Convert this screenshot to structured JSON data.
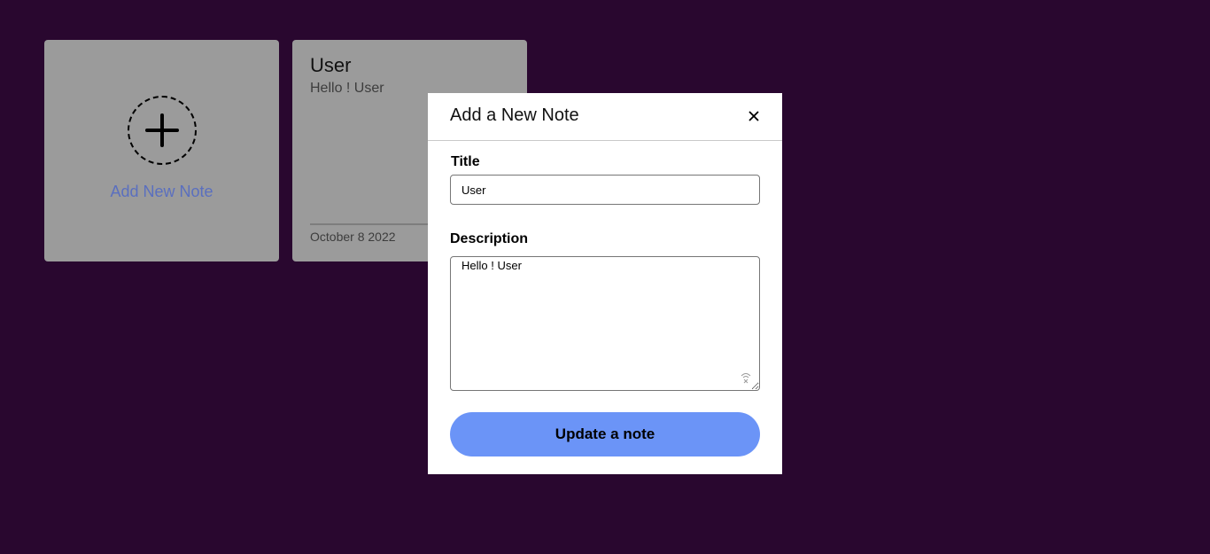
{
  "cards": {
    "add_note": {
      "label": "Add New Note",
      "icon": "plus-icon"
    },
    "note": {
      "title": "User",
      "description": "Hello ! User",
      "date": "October 8 2022"
    }
  },
  "modal": {
    "title": "Add a New Note",
    "close_icon": "close-icon",
    "title_label": "Title",
    "title_value": "User",
    "description_label": "Description",
    "description_value": "Hello ! User",
    "submit_label": "Update a note"
  },
  "colors": {
    "background": "#29072f",
    "card": "#9b9b9b",
    "accent_link": "#5a6fbf",
    "button": "#6b94f7"
  }
}
